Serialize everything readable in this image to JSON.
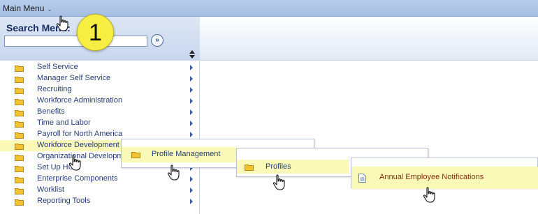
{
  "topbar": {
    "main_menu_label": "Main Menu"
  },
  "search": {
    "label": "Search Menu:",
    "value": "",
    "go_label": "»"
  },
  "callout": {
    "number": "1"
  },
  "menu": {
    "items": [
      {
        "label": "Self Service"
      },
      {
        "label": "Manager Self Service"
      },
      {
        "label": "Recruiting"
      },
      {
        "label": "Workforce Administration"
      },
      {
        "label": "Benefits"
      },
      {
        "label": "Time and Labor"
      },
      {
        "label": "Payroll for North America"
      },
      {
        "label": "Workforce Development"
      },
      {
        "label": "Organizational Development"
      },
      {
        "label": "Set Up HCM"
      },
      {
        "label": "Enterprise Components"
      },
      {
        "label": "Worklist"
      },
      {
        "label": "Reporting Tools"
      }
    ],
    "highlighted_index": 7
  },
  "flyouts": {
    "level1": {
      "label": "Profile Management"
    },
    "level2": {
      "label": "Profiles"
    },
    "level3": {
      "label": "Annual Employee Notifications"
    }
  },
  "colors": {
    "highlight": "#fbf9b8",
    "link": "#26407e",
    "callout": "#f6ee42",
    "folder": "#f1c232",
    "final_item": "#8a2e12"
  }
}
